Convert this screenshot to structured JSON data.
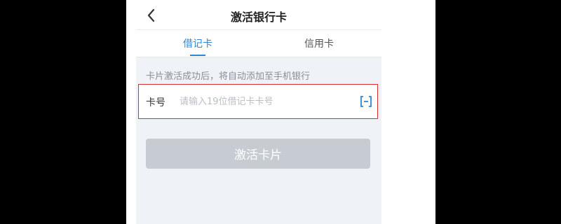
{
  "header": {
    "title": "激活银行卡",
    "back_icon": "chevron-left-icon"
  },
  "tabs": [
    {
      "label": "借记卡",
      "active": true
    },
    {
      "label": "信用卡",
      "active": false
    }
  ],
  "hint": "卡片激活成功后，将自动添加至手机银行",
  "card_field": {
    "label": "卡号",
    "placeholder": "请输入19位借记卡卡号",
    "value": "",
    "scan_icon": "scan-icon"
  },
  "activate_button": {
    "label": "激活卡片",
    "enabled": false
  },
  "colors": {
    "accent": "#2f86d6",
    "highlight_border": "#d72e2e",
    "disabled_button": "#c7cbd2",
    "body_background": "#eff2f6"
  }
}
